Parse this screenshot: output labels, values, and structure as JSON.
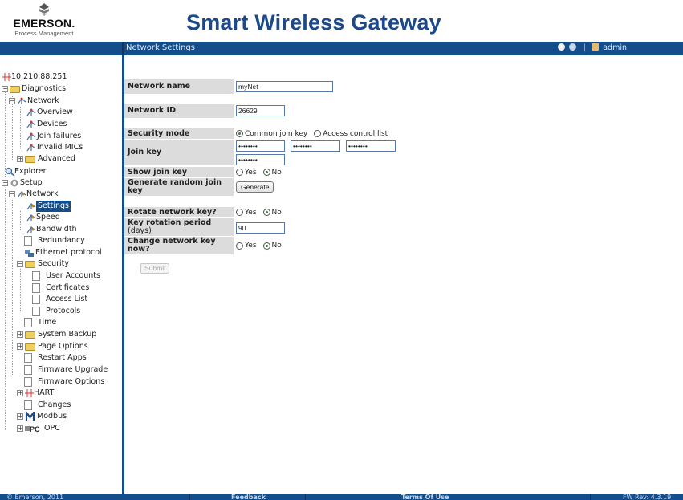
{
  "header": {
    "logo_brand": "EMERSON.",
    "logo_sub": "Process Management",
    "app_title": "Smart Wireless Gateway"
  },
  "topbar": {
    "section_title": "Network Settings",
    "user": "admin",
    "icons": [
      "help-icon",
      "info-icon",
      "user-icon"
    ]
  },
  "sidebar": {
    "items": [
      {
        "label": "10.210.88.251",
        "icon": "hart-icon"
      },
      {
        "label": "Diagnostics",
        "icon": "folder-chart-icon"
      },
      {
        "label": "Network",
        "icon": "network-icon"
      },
      {
        "label": "Overview",
        "icon": "network-icon"
      },
      {
        "label": "Devices",
        "icon": "network-icon"
      },
      {
        "label": "Join failures",
        "icon": "network-icon"
      },
      {
        "label": "Invalid MICs",
        "icon": "network-icon"
      },
      {
        "label": "Advanced",
        "icon": "folder-icon"
      },
      {
        "label": "Explorer",
        "icon": "explorer-icon"
      },
      {
        "label": "Setup",
        "icon": "setup-icon"
      },
      {
        "label": "Network",
        "icon": "network-icon"
      },
      {
        "label": "Settings",
        "icon": "network-icon"
      },
      {
        "label": "Speed",
        "icon": "network-icon"
      },
      {
        "label": "Bandwidth",
        "icon": "network-icon"
      },
      {
        "label": "Redundancy",
        "icon": "document-icon"
      },
      {
        "label": "Ethernet protocol",
        "icon": "ethernet-icon"
      },
      {
        "label": "Security",
        "icon": "folder-icon"
      },
      {
        "label": "User Accounts",
        "icon": "document-icon"
      },
      {
        "label": "Certificates",
        "icon": "document-icon"
      },
      {
        "label": "Access List",
        "icon": "document-icon"
      },
      {
        "label": "Protocols",
        "icon": "document-icon"
      },
      {
        "label": "Time",
        "icon": "document-icon"
      },
      {
        "label": "System Backup",
        "icon": "folder-icon"
      },
      {
        "label": "Page Options",
        "icon": "folder-icon"
      },
      {
        "label": "Restart Apps",
        "icon": "document-icon"
      },
      {
        "label": "Firmware Upgrade",
        "icon": "document-icon"
      },
      {
        "label": "Firmware Options",
        "icon": "document-icon"
      },
      {
        "label": "HART",
        "icon": "hart-icon"
      },
      {
        "label": "Changes",
        "icon": "document-icon"
      },
      {
        "label": "Modbus",
        "icon": "modbus-icon"
      },
      {
        "label": "OPC",
        "icon": "opc-icon"
      }
    ]
  },
  "form": {
    "network_name": {
      "label": "Network name",
      "value": "myNet"
    },
    "network_id": {
      "label": "Network ID",
      "value": "26629"
    },
    "security_mode": {
      "label": "Security mode",
      "option_common": "Common join key",
      "option_acl": "Access control list",
      "selected": "Common join key"
    },
    "join_key": {
      "label": "Join key",
      "values": [
        "••••••••",
        "••••••••",
        "••••••••",
        "••••••••"
      ]
    },
    "show_join_key": {
      "label": "Show join key",
      "yes": "Yes",
      "no": "No",
      "selected": "No"
    },
    "generate_key": {
      "label": "Generate random join key",
      "button": "Generate"
    },
    "rotate_key": {
      "label": "Rotate network key?",
      "yes": "Yes",
      "no": "No",
      "selected": "No"
    },
    "rotation_period": {
      "label": "Key rotation period",
      "unit": "(days)",
      "value": "90"
    },
    "change_key_now": {
      "label": "Change network key now?",
      "yes": "Yes",
      "no": "No",
      "selected": "No"
    },
    "submit": "Submit"
  },
  "footer": {
    "copyright": "© Emerson, 2011",
    "feedback": "Feedback",
    "terms": "Terms Of Use",
    "fw_rev": "FW Rev: 4.3.19"
  },
  "colors": {
    "accent": "#124d8c",
    "title": "#1b4a8c",
    "label_bg": "#dcdcdc"
  }
}
